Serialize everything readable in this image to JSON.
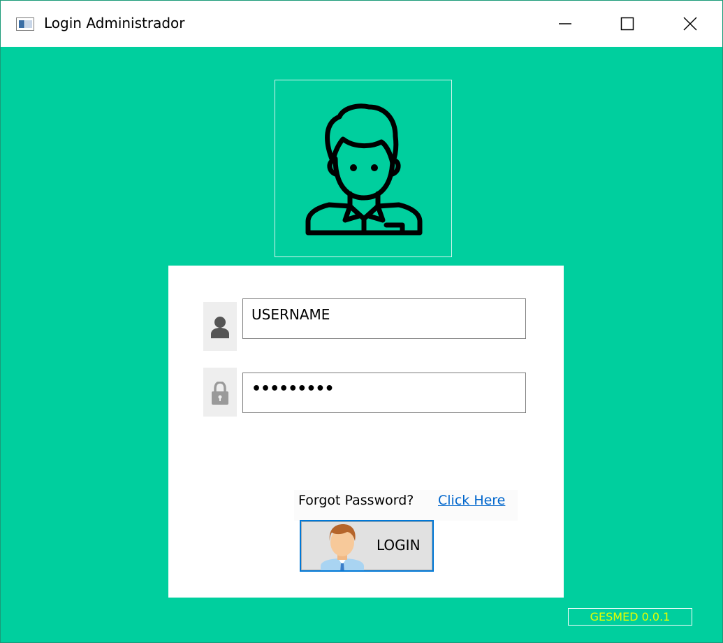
{
  "window": {
    "title": "Login Administrador",
    "icon": "app-window-icon",
    "controls": {
      "minimize": "minimize-icon",
      "maximize": "maximize-icon",
      "close": "close-icon"
    }
  },
  "header": {
    "avatar_icon": "user-avatar-icon"
  },
  "form": {
    "username": {
      "value": "USERNAME",
      "icon": "user-icon"
    },
    "password": {
      "value": "•••••••••",
      "icon": "lock-icon"
    },
    "forgot": {
      "label": "Forgot Password?",
      "link": "Click Here"
    },
    "login_button": {
      "label": "LOGIN",
      "icon": "user-avatar-color-icon"
    }
  },
  "footer": {
    "version": "GESMED 0.0.1"
  },
  "colors": {
    "background": "#00cf9e",
    "card": "#ffffff",
    "link": "#0066cc",
    "version": "#e6ff00",
    "button_border": "#0078d7"
  }
}
